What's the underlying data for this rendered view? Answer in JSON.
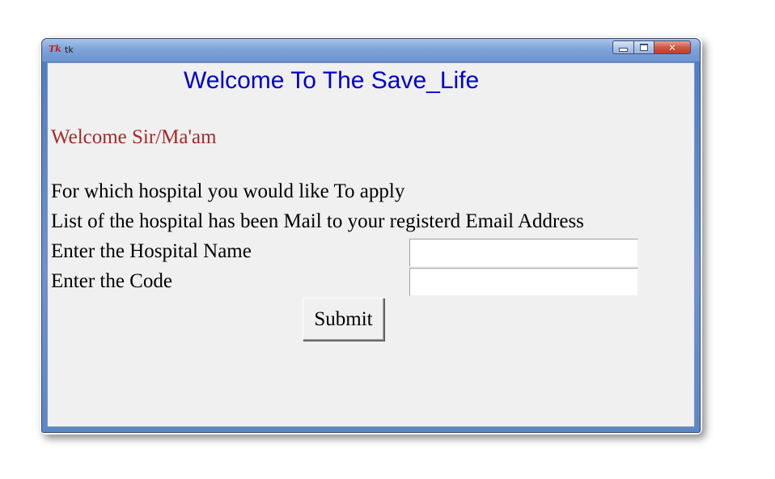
{
  "window": {
    "logo": "Tk",
    "title": "tk",
    "minimize_glyph": "",
    "maximize_glyph": "",
    "close_glyph": "✕"
  },
  "content": {
    "headline": "Welcome To The Save_Life",
    "greeting": "Welcome Sir/Ma'am",
    "question": "For which hospital you would like To apply",
    "notice": "List of the hospital has been Mail to your registerd Email Address",
    "hospital_label": "Enter the Hospital Name",
    "hospital_value": "",
    "code_label": "Enter the Code",
    "code_value": "",
    "submit_label": "Submit"
  },
  "colors": {
    "headline": "#0000cd",
    "greeting": "#a52a2a",
    "background": "#f0f0f0"
  }
}
